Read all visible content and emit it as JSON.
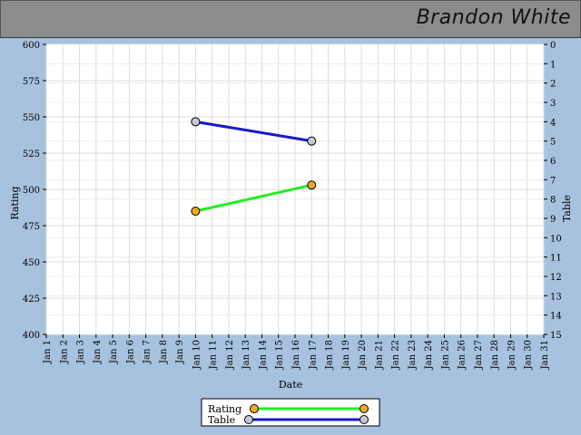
{
  "header": {
    "name": "Brandon White"
  },
  "chart_data": {
    "type": "line",
    "xlabel": "Date",
    "ylabel_left": "Rating",
    "ylabel_right": "Table",
    "x_categories": [
      "Jan 1",
      "Jan 2",
      "Jan 3",
      "Jan 4",
      "Jan 5",
      "Jan 6",
      "Jan 7",
      "Jan 8",
      "Jan 9",
      "Jan 10",
      "Jan 11",
      "Jan 12",
      "Jan 13",
      "Jan 14",
      "Jan 15",
      "Jan 16",
      "Jan 17",
      "Jan 18",
      "Jan 19",
      "Jan 20",
      "Jan 21",
      "Jan 22",
      "Jan 23",
      "Jan 24",
      "Jan 25",
      "Jan 26",
      "Jan 27",
      "Jan 28",
      "Jan 29",
      "Jan 30",
      "Jan 31"
    ],
    "ylim_left": [
      400,
      600
    ],
    "yticks_left": [
      400,
      425,
      450,
      475,
      500,
      525,
      550,
      575,
      600
    ],
    "ylim_right": [
      15,
      0
    ],
    "yticks_right": [
      0,
      1,
      2,
      3,
      4,
      5,
      6,
      7,
      8,
      9,
      10,
      11,
      12,
      13,
      14,
      15
    ],
    "grid": true,
    "legend_position": "bottom-center",
    "series": [
      {
        "name": "Rating",
        "axis": "left",
        "color": "#22ee22",
        "marker_color": "#f5a623",
        "points": [
          {
            "x": "Jan 10",
            "y": 485
          },
          {
            "x": "Jan 17",
            "y": 503
          }
        ]
      },
      {
        "name": "Table",
        "axis": "right",
        "color": "#1818cc",
        "marker_color": "#c8c8d4",
        "points": [
          {
            "x": "Jan 10",
            "y": 4
          },
          {
            "x": "Jan 17",
            "y": 5
          }
        ]
      }
    ]
  }
}
